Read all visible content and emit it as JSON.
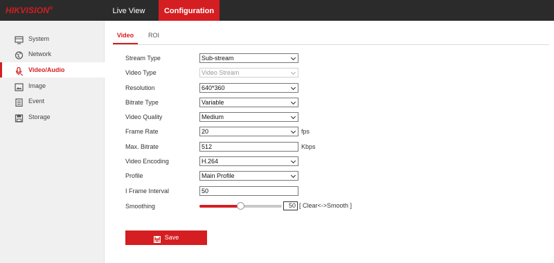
{
  "brand": {
    "logo_text": "HIKVISION",
    "logo_mark": "®",
    "accent": "#d51e21"
  },
  "nav": {
    "live_view": "Live View",
    "configuration": "Configuration"
  },
  "sidebar": {
    "items": [
      {
        "label": "System",
        "icon": "monitor-icon"
      },
      {
        "label": "Network",
        "icon": "globe-icon"
      },
      {
        "label": "Video/Audio",
        "icon": "microphone-icon",
        "active": true
      },
      {
        "label": "Image",
        "icon": "image-icon"
      },
      {
        "label": "Event",
        "icon": "calendar-icon"
      },
      {
        "label": "Storage",
        "icon": "disk-icon"
      }
    ]
  },
  "tabs": {
    "video": "Video",
    "roi": "ROI"
  },
  "form": {
    "stream_type": {
      "label": "Stream Type",
      "value": "Sub-stream"
    },
    "video_type": {
      "label": "Video Type",
      "value": "Video Stream"
    },
    "resolution": {
      "label": "Resolution",
      "value": "640*360"
    },
    "bitrate_type": {
      "label": "Bitrate Type",
      "value": "Variable"
    },
    "video_quality": {
      "label": "Video Quality",
      "value": "Medium"
    },
    "frame_rate": {
      "label": "Frame Rate",
      "value": "20",
      "unit": "fps"
    },
    "max_bitrate": {
      "label": "Max. Bitrate",
      "value": "512",
      "unit": "Kbps"
    },
    "video_encoding": {
      "label": "Video Encoding",
      "value": "H.264"
    },
    "profile": {
      "label": "Profile",
      "value": "Main Profile"
    },
    "i_frame_interval": {
      "label": "I Frame Interval",
      "value": "50"
    },
    "smoothing": {
      "label": "Smoothing",
      "value": "50",
      "fraction": 0.5,
      "hint": "[ Clear<->Smooth ]"
    }
  },
  "save_label": "Save"
}
